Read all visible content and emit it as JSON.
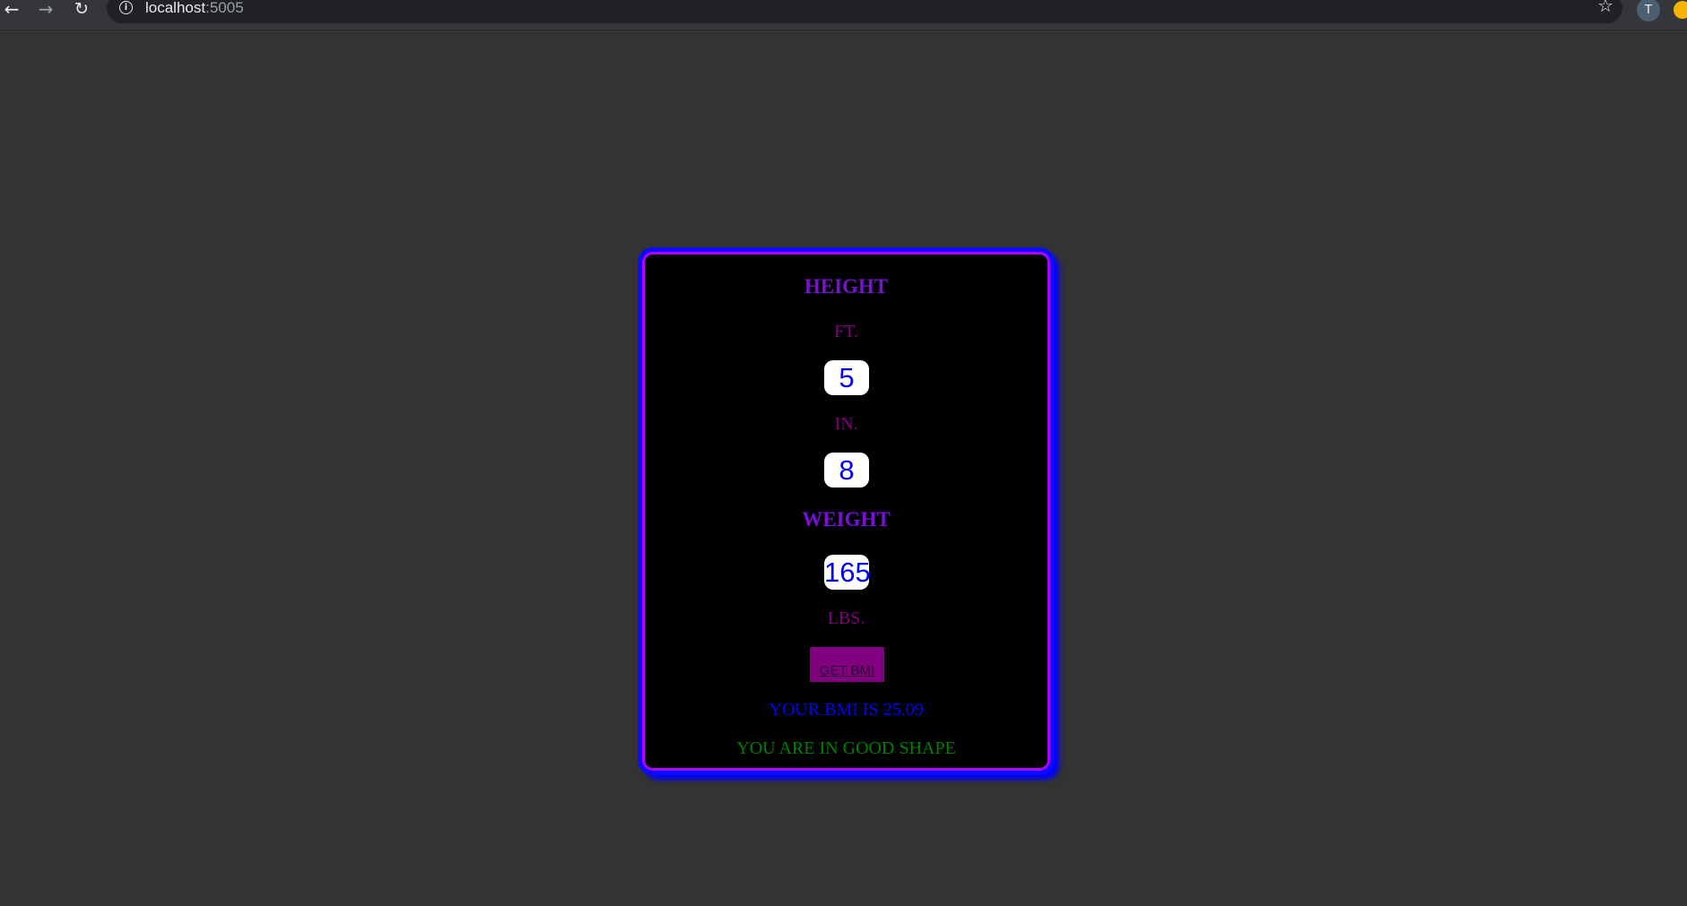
{
  "browser": {
    "back_icon": "←",
    "forward_icon": "→",
    "reload_icon": "↻",
    "info_icon": "i",
    "url_host": "localhost",
    "url_port": ":5005",
    "star_icon": "☆",
    "avatar_initial": "T"
  },
  "form": {
    "height_heading": "HEIGHT",
    "feet_label": "FT.",
    "feet_value": "5",
    "inches_label": "IN.",
    "inches_value": "8",
    "weight_heading": "WEIGHT",
    "weight_value": "165",
    "pounds_label": "LBS.",
    "submit_label": "GET BMI"
  },
  "result": {
    "bmi_text": "YOUR BMI IS 25.09",
    "status_text": "YOU ARE IN GOOD SHAPE"
  },
  "colors": {
    "page_background": "#333333",
    "card_background": "#000000",
    "card_glow": "#0000ff",
    "card_border": "#b000ff",
    "heading": "#7a0fd6",
    "unit_label": "#800080",
    "input_text": "#0000ff",
    "button_background": "#800080",
    "bmi_text": "#0000ff",
    "status_text": "#008000"
  }
}
